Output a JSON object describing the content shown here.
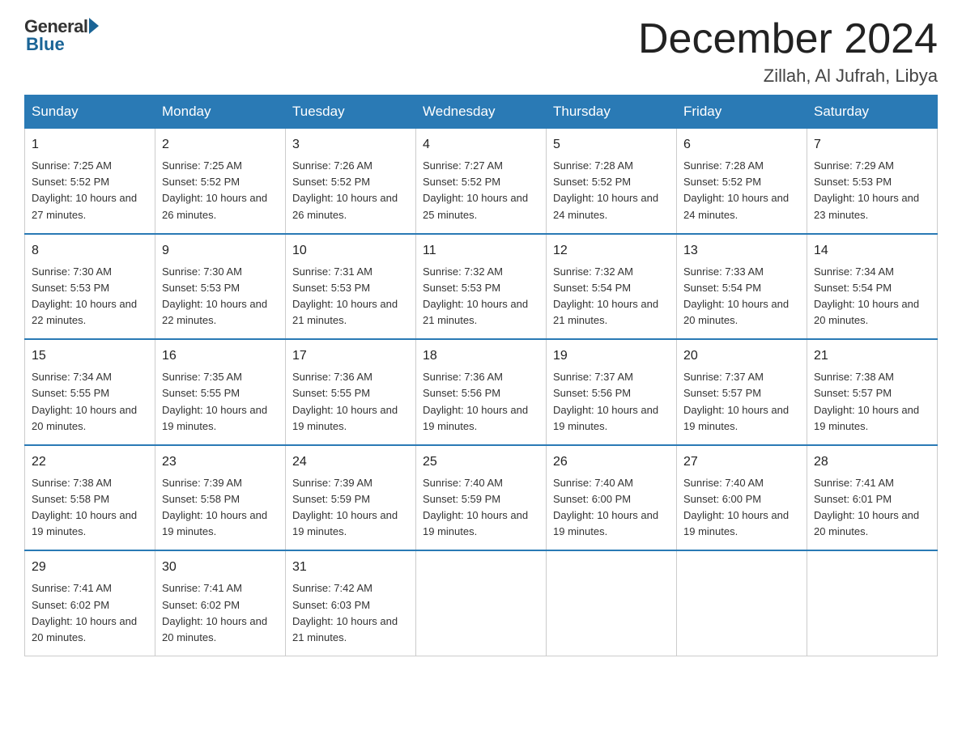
{
  "logo": {
    "general": "General",
    "blue": "Blue"
  },
  "title": "December 2024",
  "location": "Zillah, Al Jufrah, Libya",
  "days_of_week": [
    "Sunday",
    "Monday",
    "Tuesday",
    "Wednesday",
    "Thursday",
    "Friday",
    "Saturday"
  ],
  "weeks": [
    [
      {
        "day": "1",
        "sunrise": "7:25 AM",
        "sunset": "5:52 PM",
        "daylight": "10 hours and 27 minutes."
      },
      {
        "day": "2",
        "sunrise": "7:25 AM",
        "sunset": "5:52 PM",
        "daylight": "10 hours and 26 minutes."
      },
      {
        "day": "3",
        "sunrise": "7:26 AM",
        "sunset": "5:52 PM",
        "daylight": "10 hours and 26 minutes."
      },
      {
        "day": "4",
        "sunrise": "7:27 AM",
        "sunset": "5:52 PM",
        "daylight": "10 hours and 25 minutes."
      },
      {
        "day": "5",
        "sunrise": "7:28 AM",
        "sunset": "5:52 PM",
        "daylight": "10 hours and 24 minutes."
      },
      {
        "day": "6",
        "sunrise": "7:28 AM",
        "sunset": "5:52 PM",
        "daylight": "10 hours and 24 minutes."
      },
      {
        "day": "7",
        "sunrise": "7:29 AM",
        "sunset": "5:53 PM",
        "daylight": "10 hours and 23 minutes."
      }
    ],
    [
      {
        "day": "8",
        "sunrise": "7:30 AM",
        "sunset": "5:53 PM",
        "daylight": "10 hours and 22 minutes."
      },
      {
        "day": "9",
        "sunrise": "7:30 AM",
        "sunset": "5:53 PM",
        "daylight": "10 hours and 22 minutes."
      },
      {
        "day": "10",
        "sunrise": "7:31 AM",
        "sunset": "5:53 PM",
        "daylight": "10 hours and 21 minutes."
      },
      {
        "day": "11",
        "sunrise": "7:32 AM",
        "sunset": "5:53 PM",
        "daylight": "10 hours and 21 minutes."
      },
      {
        "day": "12",
        "sunrise": "7:32 AM",
        "sunset": "5:54 PM",
        "daylight": "10 hours and 21 minutes."
      },
      {
        "day": "13",
        "sunrise": "7:33 AM",
        "sunset": "5:54 PM",
        "daylight": "10 hours and 20 minutes."
      },
      {
        "day": "14",
        "sunrise": "7:34 AM",
        "sunset": "5:54 PM",
        "daylight": "10 hours and 20 minutes."
      }
    ],
    [
      {
        "day": "15",
        "sunrise": "7:34 AM",
        "sunset": "5:55 PM",
        "daylight": "10 hours and 20 minutes."
      },
      {
        "day": "16",
        "sunrise": "7:35 AM",
        "sunset": "5:55 PM",
        "daylight": "10 hours and 19 minutes."
      },
      {
        "day": "17",
        "sunrise": "7:36 AM",
        "sunset": "5:55 PM",
        "daylight": "10 hours and 19 minutes."
      },
      {
        "day": "18",
        "sunrise": "7:36 AM",
        "sunset": "5:56 PM",
        "daylight": "10 hours and 19 minutes."
      },
      {
        "day": "19",
        "sunrise": "7:37 AM",
        "sunset": "5:56 PM",
        "daylight": "10 hours and 19 minutes."
      },
      {
        "day": "20",
        "sunrise": "7:37 AM",
        "sunset": "5:57 PM",
        "daylight": "10 hours and 19 minutes."
      },
      {
        "day": "21",
        "sunrise": "7:38 AM",
        "sunset": "5:57 PM",
        "daylight": "10 hours and 19 minutes."
      }
    ],
    [
      {
        "day": "22",
        "sunrise": "7:38 AM",
        "sunset": "5:58 PM",
        "daylight": "10 hours and 19 minutes."
      },
      {
        "day": "23",
        "sunrise": "7:39 AM",
        "sunset": "5:58 PM",
        "daylight": "10 hours and 19 minutes."
      },
      {
        "day": "24",
        "sunrise": "7:39 AM",
        "sunset": "5:59 PM",
        "daylight": "10 hours and 19 minutes."
      },
      {
        "day": "25",
        "sunrise": "7:40 AM",
        "sunset": "5:59 PM",
        "daylight": "10 hours and 19 minutes."
      },
      {
        "day": "26",
        "sunrise": "7:40 AM",
        "sunset": "6:00 PM",
        "daylight": "10 hours and 19 minutes."
      },
      {
        "day": "27",
        "sunrise": "7:40 AM",
        "sunset": "6:00 PM",
        "daylight": "10 hours and 19 minutes."
      },
      {
        "day": "28",
        "sunrise": "7:41 AM",
        "sunset": "6:01 PM",
        "daylight": "10 hours and 20 minutes."
      }
    ],
    [
      {
        "day": "29",
        "sunrise": "7:41 AM",
        "sunset": "6:02 PM",
        "daylight": "10 hours and 20 minutes."
      },
      {
        "day": "30",
        "sunrise": "7:41 AM",
        "sunset": "6:02 PM",
        "daylight": "10 hours and 20 minutes."
      },
      {
        "day": "31",
        "sunrise": "7:42 AM",
        "sunset": "6:03 PM",
        "daylight": "10 hours and 21 minutes."
      },
      null,
      null,
      null,
      null
    ]
  ]
}
